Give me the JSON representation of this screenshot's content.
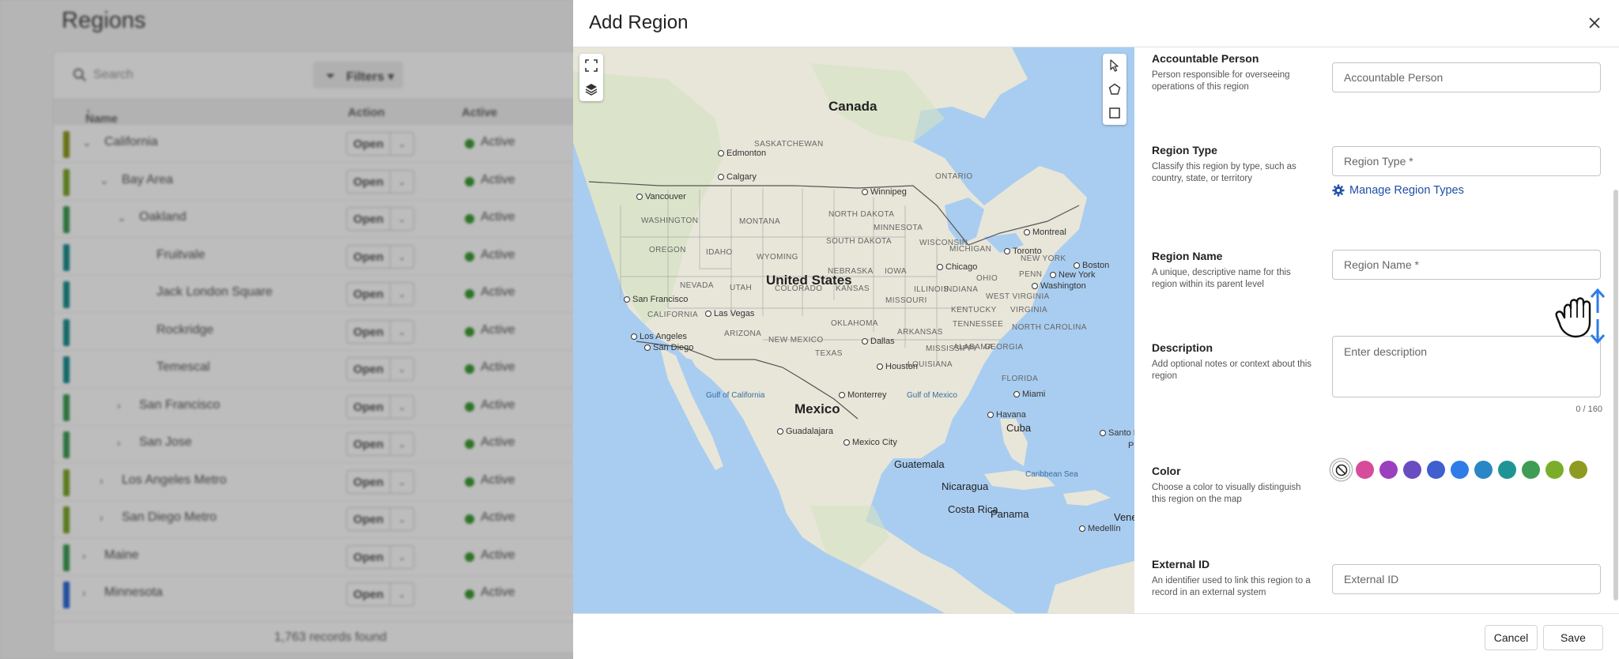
{
  "background_page": {
    "title": "Regions",
    "search_placeholder": "Search",
    "filters_label": "Filters",
    "columns": {
      "name": "Name",
      "action": "Action",
      "active": "Active"
    },
    "rows": [
      {
        "name": "California",
        "indent": 0,
        "expanded": true,
        "has_children": true,
        "color": "#8f9a22"
      },
      {
        "name": "Bay Area",
        "indent": 1,
        "expanded": true,
        "has_children": true,
        "color": "#7aa72b"
      },
      {
        "name": "Oakland",
        "indent": 2,
        "expanded": true,
        "has_children": true,
        "color": "#3f9c55"
      },
      {
        "name": "Fruitvale",
        "indent": 3,
        "expanded": false,
        "has_children": false,
        "color": "#1e8f8f"
      },
      {
        "name": "Jack London Square",
        "indent": 3,
        "expanded": false,
        "has_children": false,
        "color": "#1e8f8f"
      },
      {
        "name": "Rockridge",
        "indent": 3,
        "expanded": false,
        "has_children": false,
        "color": "#1e8f8f"
      },
      {
        "name": "Temescal",
        "indent": 3,
        "expanded": false,
        "has_children": false,
        "color": "#1e8f8f"
      },
      {
        "name": "San Francisco",
        "indent": 2,
        "expanded": false,
        "has_children": true,
        "color": "#3f9c55"
      },
      {
        "name": "San Jose",
        "indent": 2,
        "expanded": false,
        "has_children": true,
        "color": "#3f9c55"
      },
      {
        "name": "Los Angeles Metro",
        "indent": 1,
        "expanded": false,
        "has_children": true,
        "color": "#7aa72b"
      },
      {
        "name": "San Diego Metro",
        "indent": 1,
        "expanded": false,
        "has_children": true,
        "color": "#7aa72b"
      },
      {
        "name": "Maine",
        "indent": 0,
        "expanded": false,
        "has_children": true,
        "color": "#3f9c55"
      },
      {
        "name": "Minnesota",
        "indent": 0,
        "expanded": false,
        "has_children": true,
        "color": "#2e6ad8"
      }
    ],
    "action_label": "Open",
    "status_label": "Active",
    "records_text": "1,763 records found"
  },
  "modal": {
    "title": "Add Region",
    "close_icon": "close-icon",
    "map": {
      "labels": {
        "canada": "Canada",
        "united_states": "United States",
        "mexico": "Mexico",
        "edmonton": "Edmonton",
        "saskatchewan": "SASKATCHEWAN",
        "calgary": "Calgary",
        "vancouver": "Vancouver",
        "winnipeg": "Winnipeg",
        "ontario": "ONTARIO",
        "washington_state": "WASHINGTON",
        "montana": "MONTANA",
        "north_dakota": "NORTH DAKOTA",
        "minnesota": "MINNESOTA",
        "oregon": "OREGON",
        "idaho": "IDAHO",
        "south_dakota": "SOUTH DAKOTA",
        "wyoming": "WYOMING",
        "wisconsin": "WISCONSIN",
        "michigan": "MICHIGAN",
        "montreal": "Montreal",
        "toronto": "Toronto",
        "new_york": "NEW YORK",
        "nebraska": "NEBRASKA",
        "iowa": "IOWA",
        "chicago": "Chicago",
        "ohio": "OHIO",
        "penn": "PENN",
        "boston": "Boston",
        "nevada": "NEVADA",
        "utah": "UTAH",
        "colorado": "COLORADO",
        "kansas": "KANSAS",
        "illinois": "ILLINOIS",
        "indiana": "INDIANA",
        "new_york_city": "New York",
        "san_francisco": "San Francisco",
        "california_state": "CALIFORNIA",
        "missouri": "MISSOURI",
        "west_virginia": "WEST VIRGINIA",
        "washington_dc": "Washington",
        "las_vegas": "Las Vegas",
        "kentucky": "KENTUCKY",
        "virginia": "VIRGINIA",
        "arizona": "ARIZONA",
        "oklahoma": "OKLAHOMA",
        "tennessee": "TENNESSEE",
        "new_mexico": "NEW MEXICO",
        "los_angeles": "Los Angeles",
        "arkansas": "ARKANSAS",
        "north_carolina": "NORTH CAROLINA",
        "san_diego": "San Diego",
        "dallas": "Dallas",
        "mississippi": "MISSISSIPPI",
        "alabama": "ALABAMA",
        "georgia": "GEORGIA",
        "texas": "TEXAS",
        "louisiana": "LOUISIANA",
        "houston": "Houston",
        "florida": "FLORIDA",
        "gulf_of_california": "Gulf of California",
        "monterrey": "Monterrey",
        "gulf_of_mexico": "Gulf of Mexico",
        "miami": "Miami",
        "havana": "Havana",
        "cuba": "Cuba",
        "guadalajara": "Guadalajara",
        "mexico_city": "Mexico City",
        "santo_domingo": "Santo Domingo",
        "puerto": "Pue",
        "guatemala": "Guatemala",
        "caribbean_sea": "Caribbean Sea",
        "nicaragua": "Nicaragua",
        "costa_rica": "Costa Rica",
        "panama": "Panama",
        "medellin": "Medellín",
        "venezuela": "Venez"
      },
      "controls": {
        "fullscreen_icon": "fullscreen-icon",
        "layers_icon": "layers-icon",
        "pointer_icon": "pointer-tool-icon",
        "polygon_icon": "polygon-tool-icon",
        "rectangle_icon": "rectangle-tool-icon"
      }
    },
    "form": {
      "accountable_person": {
        "label": "Accountable Person",
        "description": "Person responsible for overseeing operations of this region",
        "placeholder": "Accountable Person"
      },
      "region_type": {
        "label": "Region Type",
        "description": "Classify this region by type, such as country, state, or territory",
        "placeholder": "Region Type *",
        "manage_link": "Manage Region Types",
        "manage_icon": "gear-icon"
      },
      "region_name": {
        "label": "Region Name",
        "description": "A unique, descriptive name for this region within its parent level",
        "placeholder": "Region Name *"
      },
      "description": {
        "label": "Description",
        "description": "Add optional notes or context about this region",
        "placeholder": "Enter description",
        "counter": "0 / 160"
      },
      "color": {
        "label": "Color",
        "description": "Choose a color to visually distinguish this region on the map",
        "selected": "none",
        "swatches": [
          "none",
          "#d64b9a",
          "#9b3fbf",
          "#6a4cc1",
          "#3f5fcf",
          "#2f7be8",
          "#2a86c4",
          "#1f9494",
          "#3f9c55",
          "#7aae2a",
          "#8f9a22"
        ]
      },
      "external_id": {
        "label": "External ID",
        "description": "An identifier used to link this region to a record in an external system",
        "placeholder": "External ID"
      }
    },
    "footer": {
      "cancel_label": "Cancel",
      "save_label": "Save"
    }
  }
}
